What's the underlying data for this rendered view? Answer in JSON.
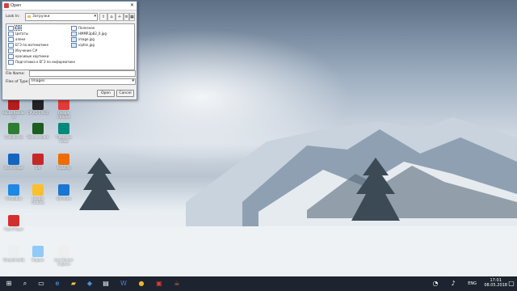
{
  "dialog": {
    "title": "Open",
    "look_in_label": "Look In:",
    "look_in_value": "Загрузки",
    "items": [
      {
        "label": "CSI",
        "kind": "folder",
        "selected": true
      },
      {
        "label": "Цитаты",
        "kind": "folder"
      },
      {
        "label": "алеке",
        "kind": "folder"
      },
      {
        "label": "ЕГЭ по математике",
        "kind": "folder"
      },
      {
        "label": "Изучение C#",
        "kind": "folder"
      },
      {
        "label": "красивые картинки",
        "kind": "folder"
      },
      {
        "label": "Подготовка к ЕГЭ по информатике",
        "kind": "folder"
      },
      {
        "label": "Полезное",
        "kind": "folder"
      },
      {
        "label": "HMMR3p82_0.jpg",
        "kind": "image"
      },
      {
        "label": "image.jpg",
        "kind": "image"
      },
      {
        "label": "vipfon.jpg",
        "kind": "image"
      }
    ],
    "file_name_label": "File Name:",
    "file_name_value": "",
    "file_type_label": "Files of Type:",
    "file_type_value": "Images",
    "open_label": "Open",
    "cancel_label": "Cancel"
  },
  "desktop_icons": [
    {
      "label": "Adobe Reader XI",
      "color": "#b71c1c"
    },
    {
      "label": "CPUID CPU-Z",
      "color": "#222222"
    },
    {
      "label": "Google Chrome",
      "color": "#e53935"
    },
    {
      "label": "Codeblocks",
      "color": "#2e7d32"
    },
    {
      "label": "Wondershare",
      "color": "#1b5e20"
    },
    {
      "label": "Freemake Video",
      "color": "#00897b"
    },
    {
      "label": "TeamViewer",
      "color": "#1565c0"
    },
    {
      "label": "SAI",
      "color": "#c62828"
    },
    {
      "label": "Audacity",
      "color": "#ef6c00"
    },
    {
      "label": "VirtualBox",
      "color": "#1e88e5"
    },
    {
      "label": "Google Chrome",
      "color": "#fbc02d"
    },
    {
      "label": "Windows",
      "color": "#1976d2"
    },
    {
      "label": "Flash Player",
      "color": "#d32f2f"
    },
    {
      "label": "SimpleIntelliJ",
      "color": "#eceff1"
    },
    {
      "label": "Яндекс",
      "color": "#90caf9"
    },
    {
      "label": "Live Screen Capture",
      "color": "#eeeeee"
    }
  ],
  "taskbar": {
    "time": "17:01",
    "date": "08.05.2018",
    "lang": "ENG"
  }
}
